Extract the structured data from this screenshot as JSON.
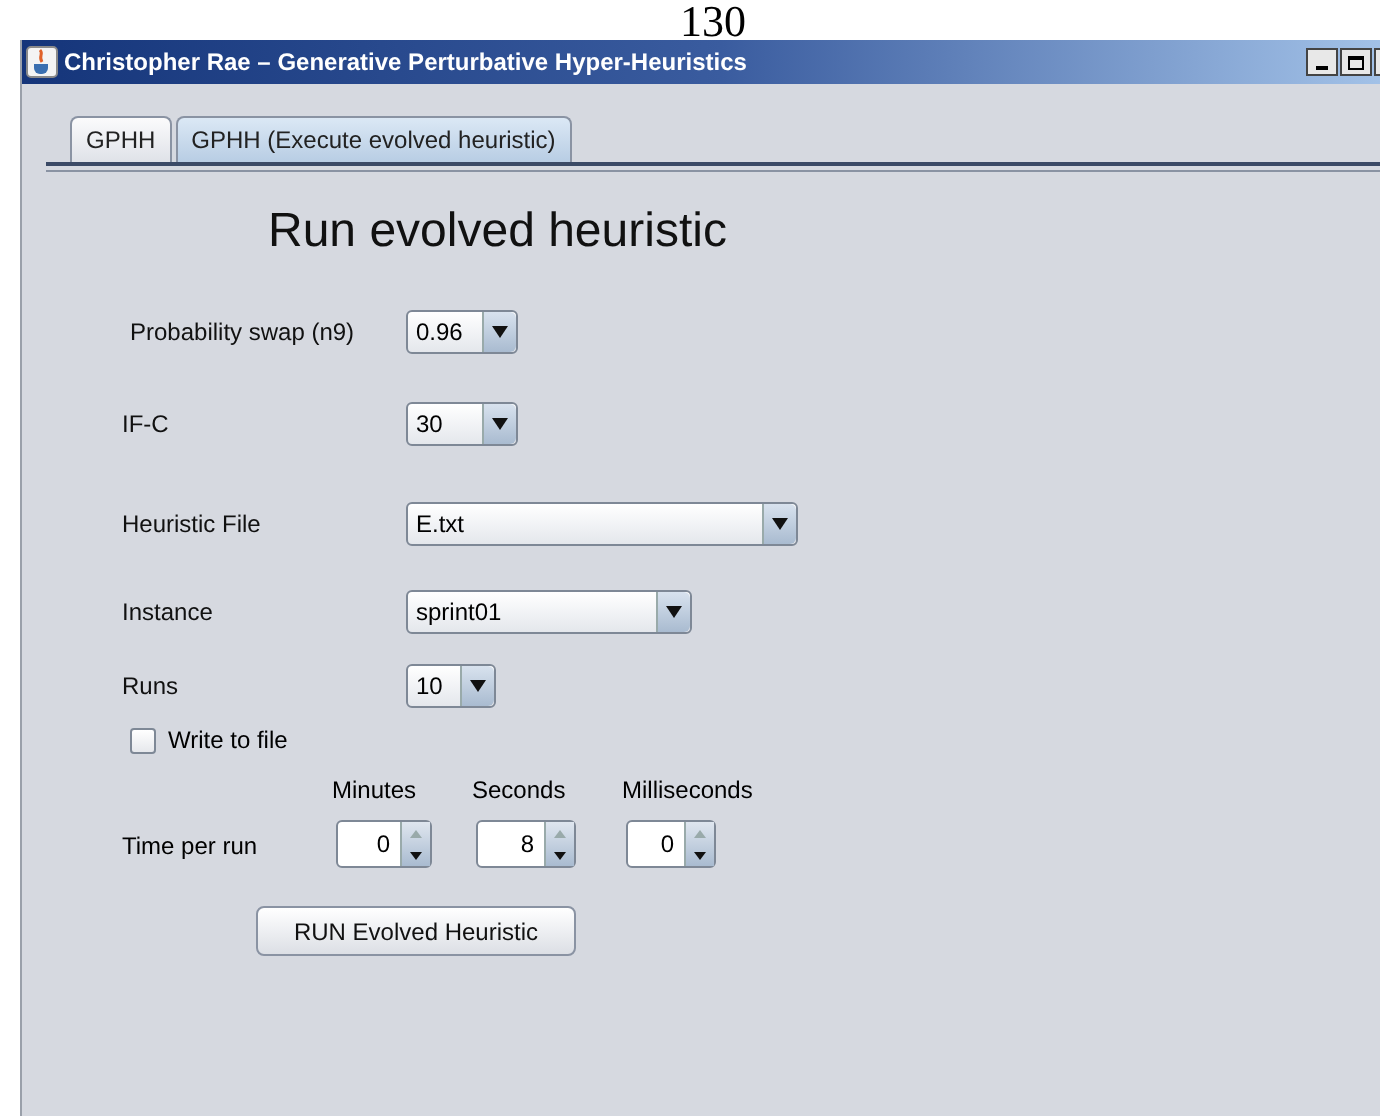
{
  "page_number": "130",
  "window": {
    "title": "Christopher Rae – Generative Perturbative Hyper-Heuristics"
  },
  "tabs": [
    {
      "label": "GPHH",
      "selected": false
    },
    {
      "label": "GPHH (Execute evolved heuristic)",
      "selected": true
    }
  ],
  "heading": "Run evolved heuristic",
  "fields": [
    {
      "label": "Probability swap (n9)",
      "value": "0.96"
    },
    {
      "label": "IF-C",
      "value": "30"
    },
    {
      "label": "Heuristic File",
      "value": "E.txt"
    },
    {
      "label": "Instance",
      "value": "sprint01"
    },
    {
      "label": "Runs",
      "value": "10"
    }
  ],
  "write_to_file": {
    "label": "Write to file",
    "checked": false
  },
  "time": {
    "label": "Time per run",
    "spinners": [
      {
        "header": "Minutes",
        "value": "0"
      },
      {
        "header": "Seconds",
        "value": "8"
      },
      {
        "header": "Milliseconds",
        "value": "0"
      }
    ]
  },
  "run_button": "RUN Evolved Heuristic"
}
